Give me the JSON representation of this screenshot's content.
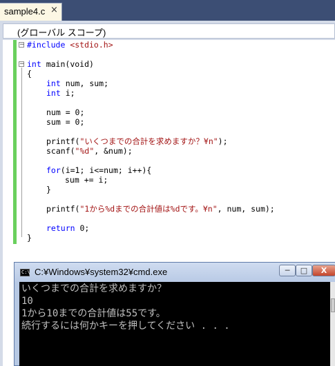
{
  "editor": {
    "tab_label": "sample4.c",
    "tab_close": "×",
    "scope": "(グローバル スコープ)",
    "fold_open_symbol": "⊟",
    "code": {
      "l1_pp": "#include",
      "l1_inc": " <stdio.h>",
      "l3_kw": "int",
      "l3_rest": " main(void)",
      "l4": "{",
      "l5_kw": "int",
      "l5_rest": " num, sum;",
      "l6_kw": "int",
      "l6_rest": " i;",
      "l8": "num = 0;",
      "l9": "sum = 0;",
      "l11_a": "printf(",
      "l11_str": "\"いくつまでの合計を求めますか？¥n\"",
      "l11_b": ");",
      "l12_a": "scanf(",
      "l12_str": "\"%d\"",
      "l12_b": ", &num);",
      "l14_kw": "for",
      "l14_rest": "(i=1; i<=num; i++){",
      "l15": "sum += i;",
      "l16": "}",
      "l18_a": "printf(",
      "l18_str": "\"1から%dまでの合計値は%dです。¥n\"",
      "l18_b": ", num, sum);",
      "l20_kw": "return",
      "l20_rest": " 0;",
      "l21": "}"
    }
  },
  "cmd": {
    "title": "C:¥Windows¥system32¥cmd.exe",
    "icon_text": "C:\\",
    "min_label": "─",
    "max_label": "□",
    "close_label": "X",
    "lines": [
      "いくつまでの合計を求めますか？",
      "10",
      "1から10までの合計値は55です。",
      "続行するには何かキーを押してください . . ."
    ]
  },
  "colors": {
    "keyword": "#0000ff",
    "string": "#a31515",
    "change_bar": "#6ad05d",
    "console_bg": "#000000",
    "console_text": "#c0c0c0"
  }
}
